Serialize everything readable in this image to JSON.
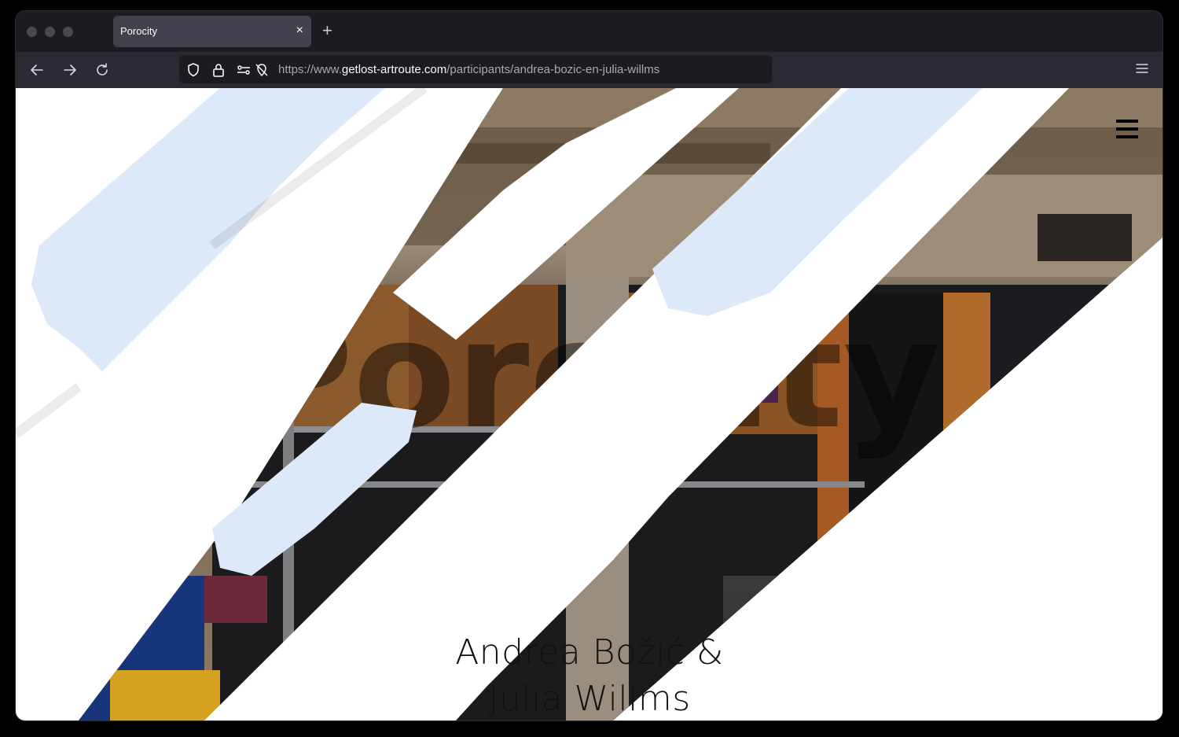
{
  "browser": {
    "tab_title": "Porocity",
    "tab_close": "×",
    "new_tab": "+",
    "url_prefix": "https://www.",
    "url_domain": "getlost-artroute.com",
    "url_path": "/participants/andrea-bozic-en-julia-willms"
  },
  "page": {
    "title_line1": "Andrea Božić &",
    "title_line2": "Julia Willms",
    "background_word": "Porocity"
  },
  "colors": {
    "chrome_dark": "#1c1b22",
    "toolbar": "#2b2a33",
    "stripe_light_blue": "#dbe9f8",
    "page_bg": "#ffffff"
  },
  "icons": [
    "back-icon",
    "forward-icon",
    "reload-icon",
    "shield-icon",
    "lock-icon",
    "permissions-icon",
    "tracking-icon",
    "app-menu-icon",
    "hamburger-menu-icon"
  ]
}
